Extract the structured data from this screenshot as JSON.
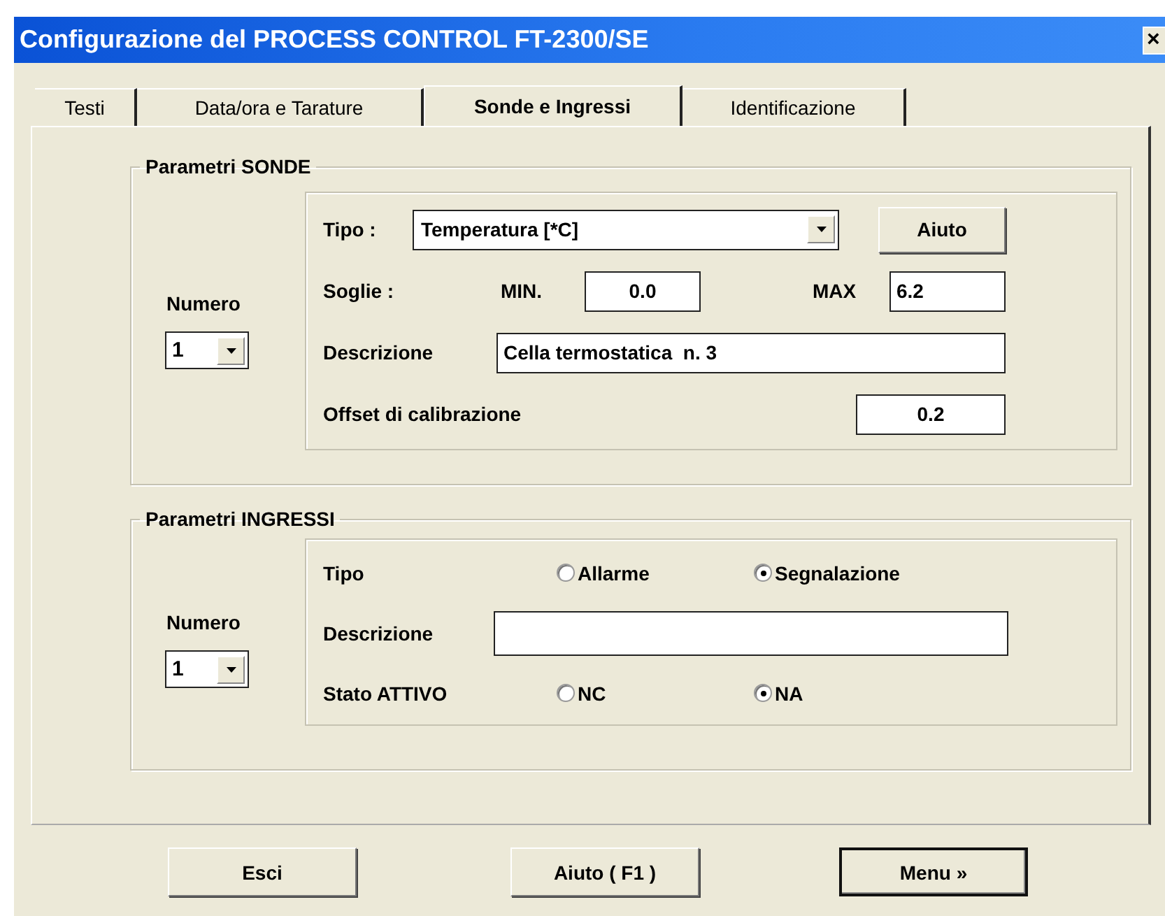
{
  "window": {
    "title": "Configurazione del PROCESS CONTROL FT-2300/SE",
    "close_label": "×"
  },
  "tabs": [
    {
      "label": "Testi",
      "selected": false
    },
    {
      "label": "Data/ora e Tarature",
      "selected": false
    },
    {
      "label": "Sonde e Ingressi",
      "selected": true
    },
    {
      "label": "Identificazione",
      "selected": false
    }
  ],
  "probes": {
    "title": "Parametri SONDE",
    "number_label": "Numero",
    "number_value": "1",
    "type_label": "Tipo :",
    "type_value": "Temperatura [*C]",
    "help_button": "Aiuto",
    "thresholds_label": "Soglie :",
    "min_label": "MIN.",
    "min_value": "0.0",
    "max_label": "MAX",
    "max_value": "6.2",
    "description_label": "Descrizione",
    "description_value": "Cella termostatica  n. 3",
    "offset_label": "Offset di calibrazione",
    "offset_value": "0.2"
  },
  "inputs": {
    "title": "Parametri INGRESSI",
    "number_label": "Numero",
    "number_value": "1",
    "type_label": "Tipo",
    "type_options": [
      {
        "label": "Allarme",
        "selected": false
      },
      {
        "label": "Segnalazione",
        "selected": true
      }
    ],
    "description_label": "Descrizione",
    "state_label": "Stato ATTIVO",
    "state_options": [
      {
        "label": "NC",
        "selected": false
      },
      {
        "label": "NA",
        "selected": true
      }
    ]
  },
  "buttons": [
    {
      "label": "Esci",
      "default": false
    },
    {
      "label": "Aiuto ( F1 )",
      "default": false
    },
    {
      "label": "Menu »",
      "default": true
    }
  ]
}
